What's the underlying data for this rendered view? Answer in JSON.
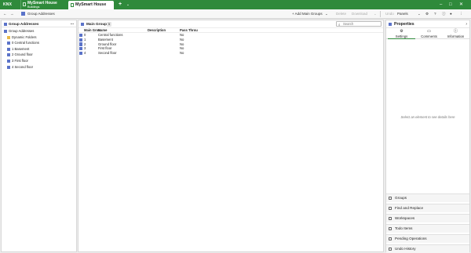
{
  "app": {
    "logo": "KNX",
    "tabs": [
      {
        "title": "MySmart House",
        "subtitle": "Buildings"
      },
      {
        "title": "MySmart House"
      }
    ],
    "add_tab_icon": "plus-icon",
    "tab_menu_icon": "chevron-down-icon"
  },
  "toolbar": {
    "back_icon": "arrow-left-icon",
    "forward_icon": "arrow-right-icon",
    "breadcrumb": "Group Addresses",
    "add_main_groups": "+ Add Main Groups",
    "delete": "Delete",
    "download": "Download",
    "undo": "Undo",
    "panels": "Panels"
  },
  "left": {
    "title": "Group Addresses",
    "more": "...",
    "tree": [
      {
        "label": "Group Addresses",
        "level": 0,
        "icon": "group-address-icon"
      },
      {
        "label": "Dynamic Folders",
        "level": 1,
        "icon": "folder-icon"
      },
      {
        "label": "0 Central functions",
        "level": 1,
        "icon": "main-group-icon"
      },
      {
        "label": "1 Basement",
        "level": 1,
        "icon": "main-group-icon"
      },
      {
        "label": "2 Ground floor",
        "level": 1,
        "icon": "main-group-icon"
      },
      {
        "label": "3 First floor",
        "level": 1,
        "icon": "main-group-icon"
      },
      {
        "label": "4 Second floor",
        "level": 1,
        "icon": "main-group-icon"
      }
    ]
  },
  "main": {
    "title": "Main Groups",
    "count": "5",
    "search_placeholder": "Search",
    "columns": [
      "Main Grou",
      "Name",
      "Description",
      "Pass Throu"
    ],
    "rows": [
      {
        "id": "0",
        "name": "Central functions",
        "description": "",
        "pass": "No"
      },
      {
        "id": "1",
        "name": "Basement",
        "description": "",
        "pass": "No"
      },
      {
        "id": "2",
        "name": "Ground floor",
        "description": "",
        "pass": "No"
      },
      {
        "id": "3",
        "name": "First floor",
        "description": "",
        "pass": "No"
      },
      {
        "id": "4",
        "name": "Second floor",
        "description": "",
        "pass": "No"
      }
    ]
  },
  "properties": {
    "title": "Properties",
    "tabs": [
      "Settings",
      "Comments",
      "Information"
    ],
    "placeholder": "Select an element to see details here",
    "panels": [
      "Groups",
      "Find and Replace",
      "Workspaces",
      "Todo Items",
      "Pending Operations",
      "Undo History"
    ]
  },
  "colors": {
    "accent": "#2f8a3b",
    "icon_blue": "#5b73c9",
    "folder": "#e9b949"
  }
}
